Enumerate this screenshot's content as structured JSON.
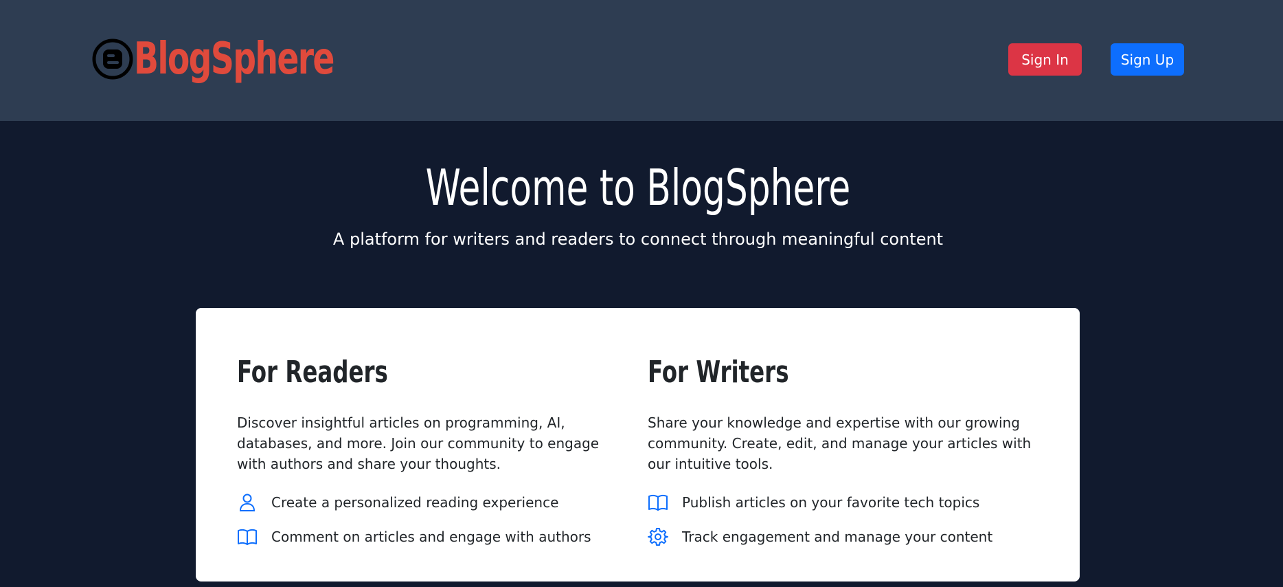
{
  "header": {
    "brand_name": "BlogSphere",
    "sign_in_label": "Sign In",
    "sign_up_label": "Sign Up"
  },
  "hero": {
    "title": "Welcome to BlogSphere",
    "subtitle": "A platform for writers and readers to connect through meaningful content"
  },
  "readers": {
    "title": "For Readers",
    "description": "Discover insightful articles on programming, AI, databases, and more. Join our community to engage with authors and share your thoughts.",
    "features": [
      {
        "icon": "person-icon",
        "label": "Create a personalized reading experience"
      },
      {
        "icon": "book-icon",
        "label": "Comment on articles and engage with authors"
      }
    ]
  },
  "writers": {
    "title": "For Writers",
    "description": "Share your knowledge and expertise with our growing community. Create, edit, and manage your articles with our intuitive tools.",
    "features": [
      {
        "icon": "book-icon",
        "label": "Publish articles on your favorite tech topics"
      },
      {
        "icon": "gear-icon",
        "label": "Track engagement and manage your content"
      }
    ]
  },
  "colors": {
    "header_bg": "#2e3d52",
    "page_bg": "#111a2e",
    "brand": "#e04a3c",
    "sign_in": "#dc3545",
    "sign_up": "#0d6efd",
    "icon_accent": "#0d6efd"
  }
}
